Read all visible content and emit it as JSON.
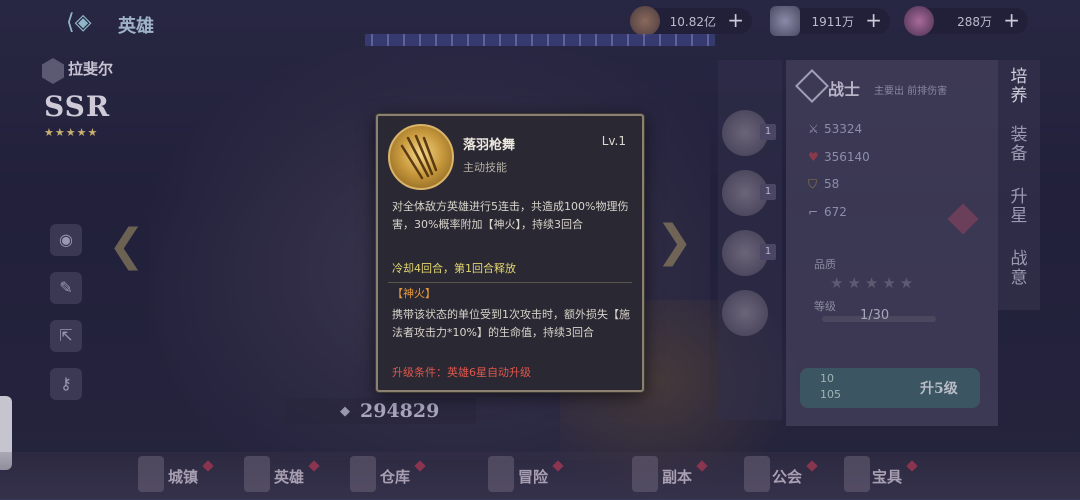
{
  "topbar": {
    "title": "英雄",
    "resources": [
      {
        "value": "10.82亿",
        "icon": "gold-coin-icon"
      },
      {
        "value": "1911万",
        "icon": "potion-icon"
      },
      {
        "value": "288万",
        "icon": "crystal-icon"
      }
    ]
  },
  "hero": {
    "name": "拉斐尔",
    "subtitle": "",
    "rarity": "SSR",
    "stars": "★★★★★",
    "power": "294829"
  },
  "right_panel": {
    "class_name": "战士",
    "class_desc": "主要出 前排伤害",
    "stats": [
      {
        "icon": "sword-icon",
        "value": "53324"
      },
      {
        "icon": "heart-icon",
        "value": "356140"
      },
      {
        "icon": "shield-icon",
        "value": "58"
      },
      {
        "icon": "boot-icon",
        "value": "672"
      }
    ],
    "quality_label": "品质",
    "level_label": "等级",
    "level_value": "1/30",
    "upgrade_costs": [
      "10",
      "105"
    ],
    "upgrade_button": "升5级",
    "skill_levels": [
      "1",
      "1",
      "1"
    ],
    "tabs": [
      "培养",
      "装备",
      "升星",
      "战意"
    ]
  },
  "bottom_nav": [
    "城镇",
    "英雄",
    "仓库",
    "冒险",
    "副本",
    "公会",
    "宝具"
  ],
  "popup": {
    "skill_name": "落羽枪舞",
    "level": "Lv.1",
    "type": "主动技能",
    "description": "对全体敌方英雄进行5连击，共造成100%物理伤害，30%概率附加【神火】，持续3回合",
    "cooldown": "冷却4回合，第1回合释放",
    "tag": "【神火】",
    "effect": "携带该状态的单位受到1次攻击时，额外损失【施法者攻击力*10%】的生命值，持续3回合",
    "condition": "升级条件：英雄6星自动升级"
  },
  "colors": {
    "popup_border": "#8c8170",
    "cooldown_text": "#e3d670",
    "tag_text": "#e5993e",
    "condition_text": "#e0574e"
  }
}
